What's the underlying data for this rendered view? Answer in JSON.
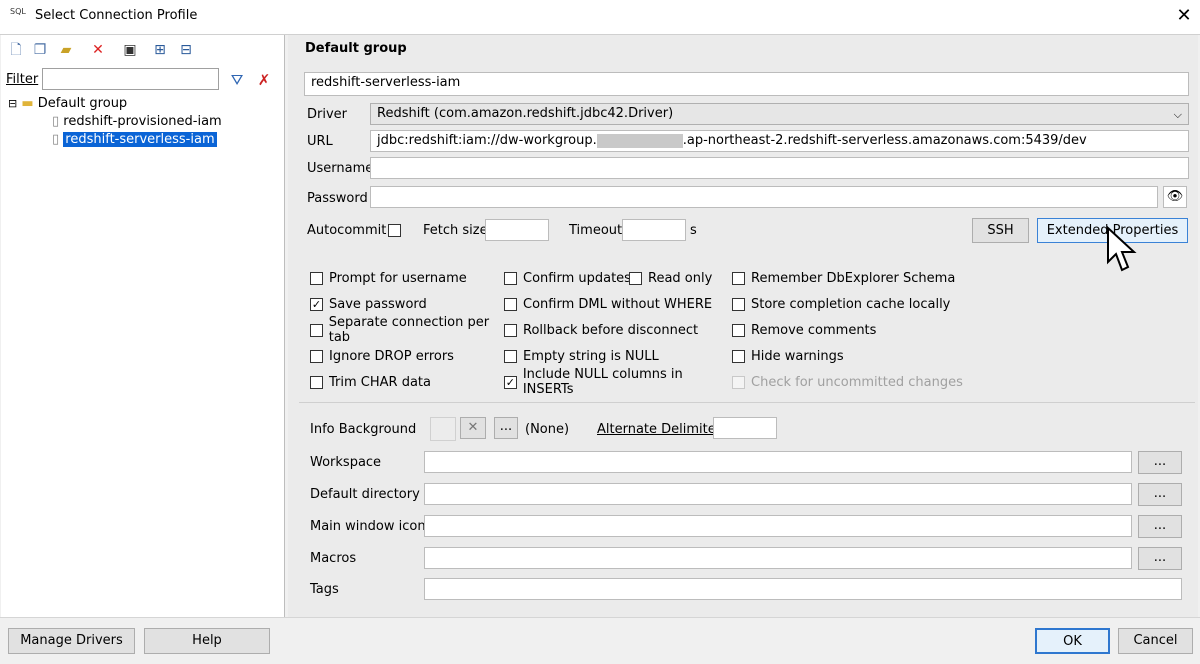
{
  "window": {
    "app_icon_text": "SQL",
    "title": "Select Connection Profile",
    "close_glyph": "✕"
  },
  "left": {
    "filter_label": "Filter",
    "tree": {
      "group": "Default group",
      "items": [
        "redshift-provisioned-iam",
        "redshift-serverless-iam"
      ],
      "selected_index": 1
    }
  },
  "right": {
    "group_header": "Default group",
    "profile_name": "redshift-serverless-iam",
    "driver_label": "Driver",
    "driver_value": "Redshift (com.amazon.redshift.jdbc42.Driver)",
    "url_label": "URL",
    "url_prefix": "jdbc:redshift:iam://dw-workgroup.",
    "url_suffix": ".ap-northeast-2.redshift-serverless.amazonaws.com:5439/dev",
    "username_label": "Username",
    "password_label": "Password",
    "autocommit_label": "Autocommit",
    "fetch_size_label": "Fetch size",
    "timeout_label": "Timeout",
    "timeout_unit": "s",
    "ssh_button": "SSH",
    "extended_button": "Extended Properties",
    "options": {
      "col1": [
        {
          "label": "Prompt for username",
          "checked": false
        },
        {
          "label": "Save password",
          "checked": true
        },
        {
          "label": "Separate connection per tab",
          "checked": false
        },
        {
          "label": "Ignore DROP errors",
          "checked": false
        },
        {
          "label": "Trim CHAR data",
          "checked": false
        }
      ],
      "col2": [
        {
          "label": "Confirm updates",
          "checked": false
        },
        {
          "label": "Confirm DML without WHERE",
          "checked": false
        },
        {
          "label": "Rollback before disconnect",
          "checked": false
        },
        {
          "label": "Empty string is NULL",
          "checked": false
        },
        {
          "label": "Include NULL columns in INSERTs",
          "checked": true
        }
      ],
      "read_only": {
        "label": "Read only",
        "checked": false
      },
      "col3": [
        {
          "label": "Remember DbExplorer Schema",
          "checked": false
        },
        {
          "label": "Store completion cache locally",
          "checked": false
        },
        {
          "label": "Remove comments",
          "checked": false
        },
        {
          "label": "Hide warnings",
          "checked": false
        },
        {
          "label": "Check for uncommitted changes",
          "checked": false,
          "disabled": true
        }
      ]
    },
    "info_background_label": "Info Background",
    "info_background_value": "(None)",
    "alternate_delimiter_label": "Alternate Delimiter",
    "browse_button": "...",
    "workspace_label": "Workspace",
    "default_directory_label": "Default directory",
    "main_window_icon_label": "Main window icon",
    "macros_label": "Macros",
    "tags_label": "Tags"
  },
  "bottom": {
    "manage_drivers": "Manage Drivers",
    "help": "Help",
    "ok": "OK",
    "cancel": "Cancel"
  }
}
